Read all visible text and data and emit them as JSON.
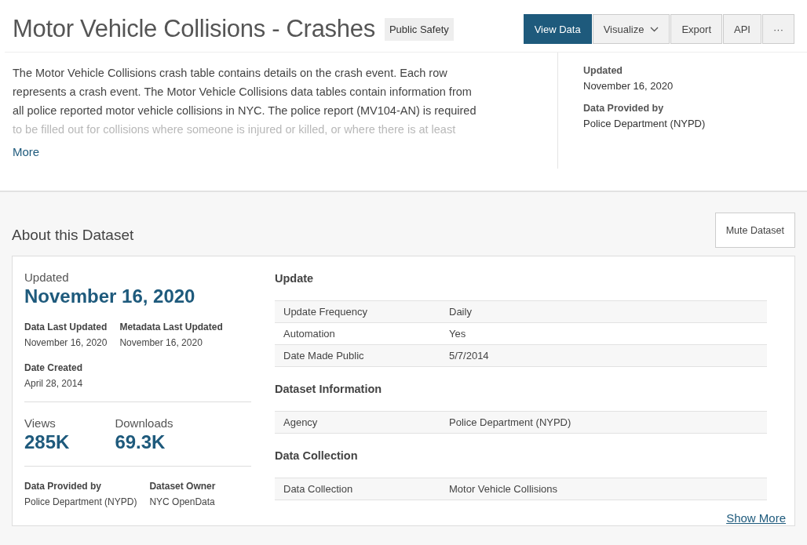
{
  "header": {
    "title": "Motor Vehicle Collisions - Crashes",
    "category": "Public Safety",
    "buttons": [
      {
        "label": "View Data",
        "selected": true,
        "kind": "plain"
      },
      {
        "label": "Visualize",
        "selected": false,
        "kind": "dropdown"
      },
      {
        "label": "Export",
        "selected": false,
        "kind": "plain"
      },
      {
        "label": "API",
        "selected": false,
        "kind": "plain"
      },
      {
        "label": "···",
        "selected": false,
        "kind": "plain"
      }
    ]
  },
  "description": {
    "lines": [
      "The Motor Vehicle Collisions crash table contains details on the crash event. Each row",
      "represents a crash event. The Motor Vehicle Collisions data tables contain information from",
      "all police reported motor vehicle collisions in NYC. The police report (MV104-AN) is required",
      "to be filled out for collisions where someone is injured or killed, or where there is at least"
    ],
    "more": "More"
  },
  "summary": [
    {
      "label": "Updated",
      "value": "November 16, 2020"
    },
    {
      "label": "Data Provided by",
      "value": "Police Department (NYPD)"
    }
  ],
  "about": {
    "title": "About this Dataset",
    "mute_button": "Mute Dataset",
    "updated_label": "Updated",
    "updated_value": "November 16, 2020",
    "dates": [
      {
        "label": "Data Last Updated",
        "value": "November 16, 2020"
      },
      {
        "label": "Metadata Last Updated",
        "value": "November 16, 2020"
      }
    ],
    "created": {
      "label": "Date Created",
      "value": "April 28, 2014"
    },
    "stats": [
      {
        "label": "Views",
        "value": "285K"
      },
      {
        "label": "Downloads",
        "value": "69.3K"
      }
    ],
    "owners": [
      {
        "label": "Data Provided by",
        "value": "Police Department (NYPD)"
      },
      {
        "label": "Dataset Owner",
        "value": "NYC OpenData"
      }
    ],
    "sections": [
      {
        "title": "Update",
        "rows": [
          {
            "key": "Update Frequency",
            "value": "Daily"
          },
          {
            "key": "Automation",
            "value": "Yes"
          },
          {
            "key": "Date Made Public",
            "value": "5/7/2014"
          }
        ]
      },
      {
        "title": "Dataset Information",
        "rows": [
          {
            "key": "Agency",
            "value": "Police Department (NYPD)"
          }
        ]
      },
      {
        "title": "Data Collection",
        "rows": [
          {
            "key": "Data Collection",
            "value": "Motor Vehicle Collisions"
          }
        ]
      }
    ],
    "show_more": "Show More"
  }
}
